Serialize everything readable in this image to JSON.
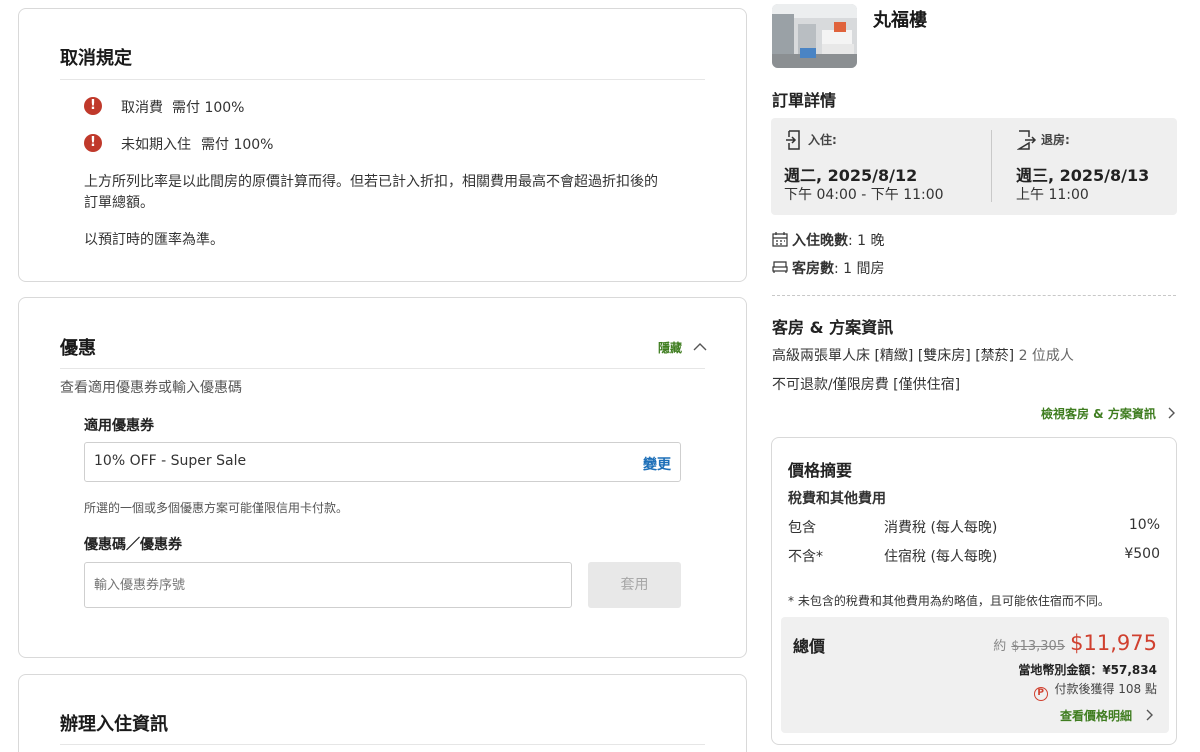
{
  "cancellation": {
    "title": "取消規定",
    "items": [
      {
        "label": "取消費",
        "value": "需付 100%"
      },
      {
        "label": "未如期入住",
        "value": "需付 100%"
      }
    ],
    "note_line1": "上方所列比率是以此間房的原價計算而得。但若已計入折扣，相關費用最高不會超過折扣後的",
    "note_line2": "訂單總額。",
    "exchange_note": "以預訂時的匯率為準。"
  },
  "discount": {
    "title": "優惠",
    "hide_label": "隱藏",
    "subtitle": "查看適用優惠券或輸入優惠碼",
    "coupon_label": "適用優惠券",
    "coupon_value": "10% OFF - Super Sale",
    "change_label": "變更",
    "coupon_note": "所選的一個或多個優惠方案可能僅限信用卡付款。",
    "code_label": "優惠碼／優惠券",
    "code_placeholder": "輸入優惠券序號",
    "apply_label": "套用"
  },
  "checkin_info": {
    "title": "辦理入住資訊"
  },
  "hotel": {
    "name": "丸福樓"
  },
  "order": {
    "title": "訂單詳情",
    "checkin_label": "入住:",
    "checkin_date": "週二, 2025/8/12",
    "checkin_time": "下午 04:00 - 下午 11:00",
    "checkout_label": "退房:",
    "checkout_date": "週三, 2025/8/13",
    "checkout_time": "上午 11:00",
    "nights_label": "入住晚數",
    "nights_value": ": 1 晚",
    "rooms_label": "客房數",
    "rooms_value": ": 1 間房"
  },
  "room": {
    "title": "客房 & 方案資訊",
    "desc": "高級兩張單人床 [精緻] [雙床房] [禁菸]",
    "guests": "2 位成人",
    "policy": "不可退款/僅限房費 [僅供住宿]",
    "view_link": "檢視客房 & 方案資訊"
  },
  "price": {
    "title": "價格摘要",
    "tax_title": "稅費和其他費用",
    "rows": [
      {
        "status": "包含",
        "name": "消費稅 (每人每晚)",
        "amount": "10%"
      },
      {
        "status": "不含*",
        "name": "住宿稅 (每人每晚)",
        "amount": "¥500"
      }
    ],
    "footnote": "* 未包含的稅費和其他費用為約略值，且可能依住宿而不同。",
    "total_label": "總價",
    "approx": "約",
    "original": "$13,305",
    "final": "$11,975",
    "local_amount": "當地幣別金額：¥57,834",
    "points": "付款後獲得 108 點",
    "points_icon": "P",
    "details_link": "查看價格明細"
  }
}
